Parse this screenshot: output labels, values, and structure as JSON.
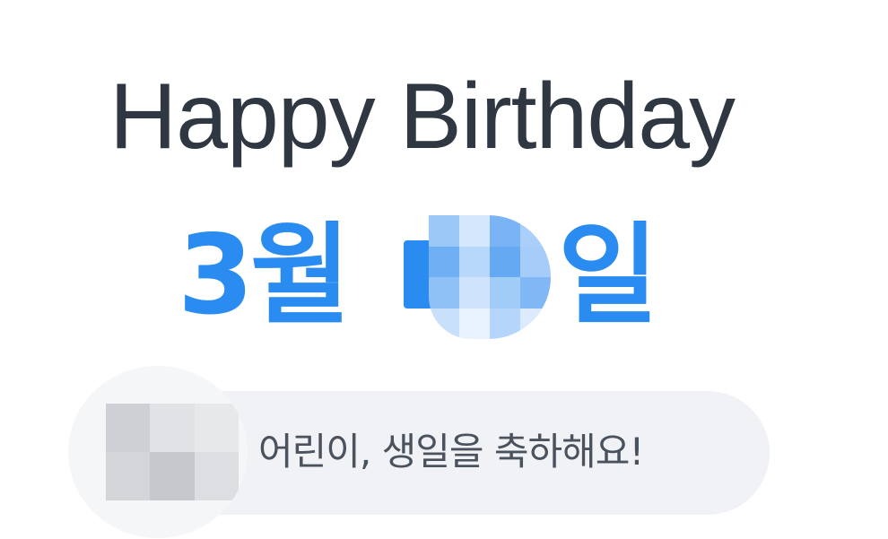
{
  "title": "Happy Birthday",
  "date": {
    "month_text": "3월",
    "day_redacted": true,
    "day_suffix": "일"
  },
  "message": {
    "text": "어린이, 생일을 축하해요!",
    "avatar_redacted": true
  },
  "colors": {
    "accent": "#2a8cf1",
    "title": "#2f3742",
    "pill_background": "#f1f2f5",
    "message_text": "#4a525e"
  }
}
